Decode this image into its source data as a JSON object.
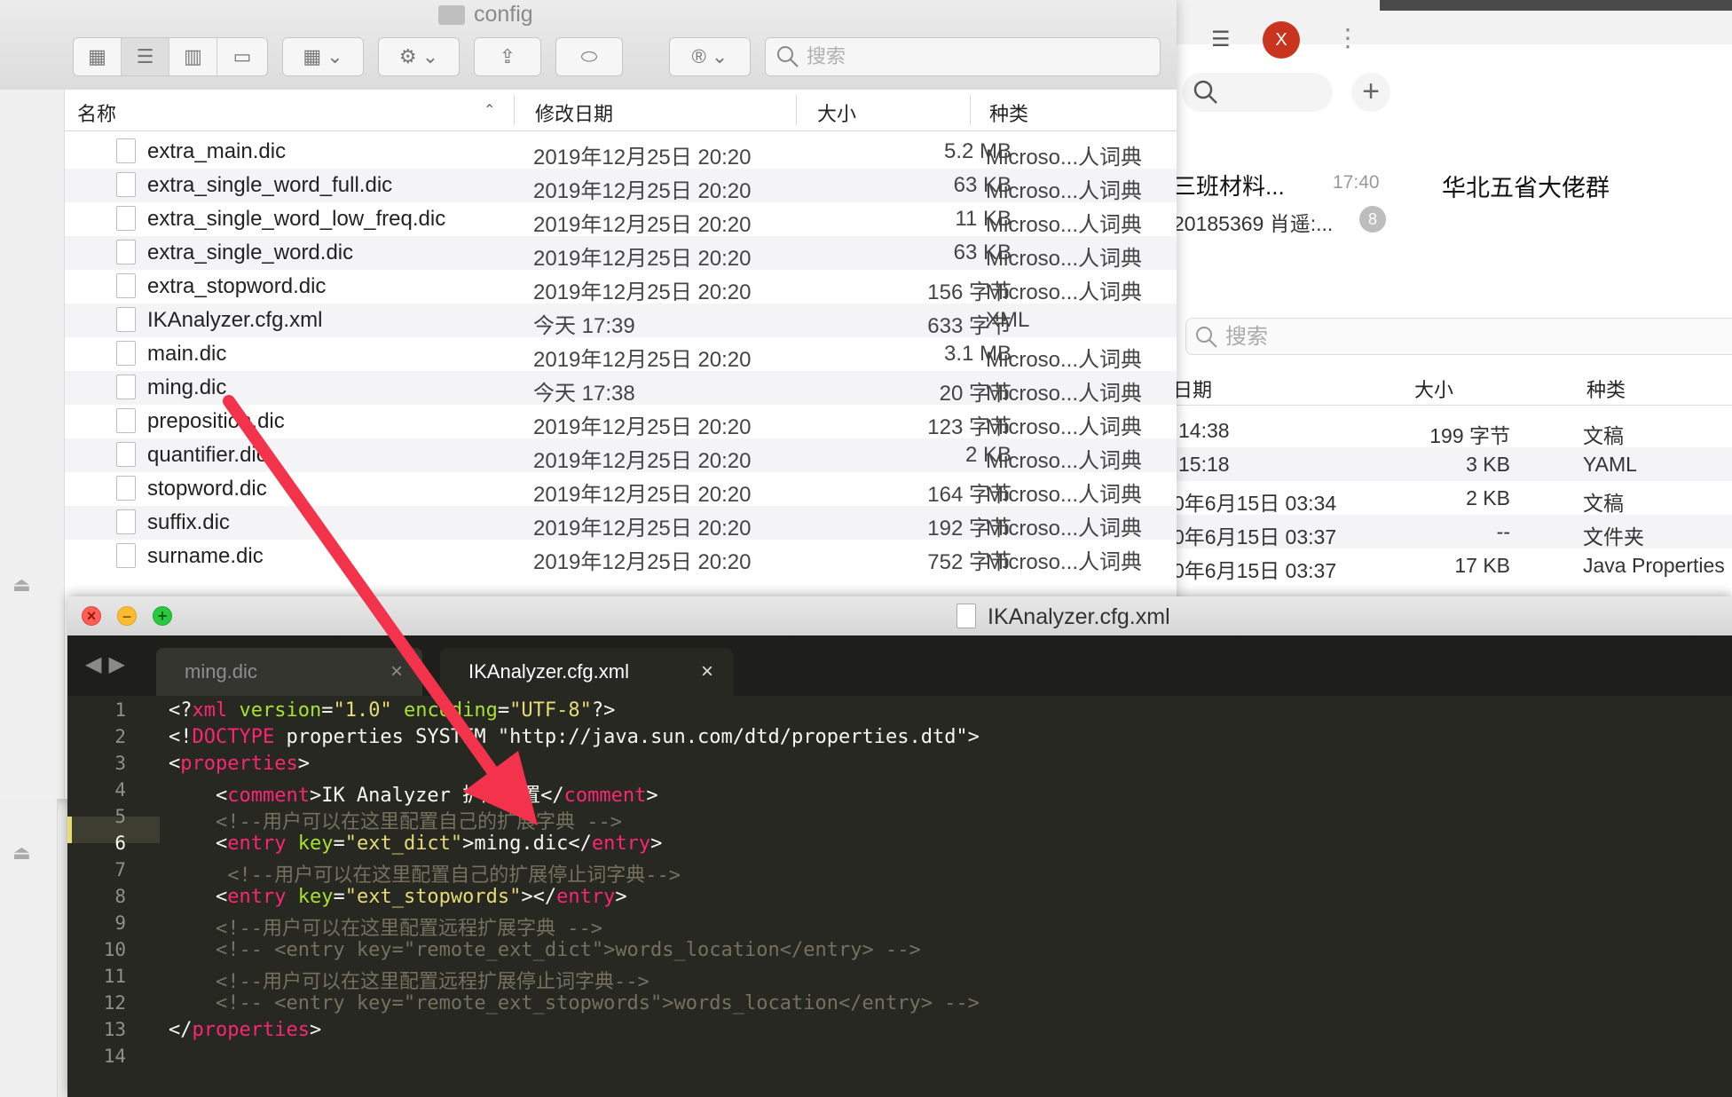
{
  "finder": {
    "window_title": "config",
    "search_placeholder": "搜索",
    "columns": {
      "name": "名称",
      "modified": "修改日期",
      "size": "大小",
      "kind": "种类"
    },
    "files": [
      {
        "name": "extra_main.dic",
        "date": "2019年12月25日 20:20",
        "size": "5.2 MB",
        "kind": "Microso...人词典"
      },
      {
        "name": "extra_single_word_full.dic",
        "date": "2019年12月25日 20:20",
        "size": "63 KB",
        "kind": "Microso...人词典"
      },
      {
        "name": "extra_single_word_low_freq.dic",
        "date": "2019年12月25日 20:20",
        "size": "11 KB",
        "kind": "Microso...人词典"
      },
      {
        "name": "extra_single_word.dic",
        "date": "2019年12月25日 20:20",
        "size": "63 KB",
        "kind": "Microso...人词典"
      },
      {
        "name": "extra_stopword.dic",
        "date": "2019年12月25日 20:20",
        "size": "156 字节",
        "kind": "Microso...人词典"
      },
      {
        "name": "IKAnalyzer.cfg.xml",
        "date": "今天 17:39",
        "size": "633 字节",
        "kind": "XML"
      },
      {
        "name": "main.dic",
        "date": "2019年12月25日 20:20",
        "size": "3.1 MB",
        "kind": "Microso...人词典"
      },
      {
        "name": "ming.dic",
        "date": "今天 17:38",
        "size": "20 字节",
        "kind": "Microso...人词典"
      },
      {
        "name": "preposition.dic",
        "date": "2019年12月25日 20:20",
        "size": "123 字节",
        "kind": "Microso...人词典"
      },
      {
        "name": "quantifier.dic",
        "date": "2019年12月25日 20:20",
        "size": "2 KB",
        "kind": "Microso...人词典"
      },
      {
        "name": "stopword.dic",
        "date": "2019年12月25日 20:20",
        "size": "164 字节",
        "kind": "Microso...人词典"
      },
      {
        "name": "suffix.dic",
        "date": "2019年12月25日 20:20",
        "size": "192 字节",
        "kind": "Microso...人词典"
      },
      {
        "name": "surname.dic",
        "date": "2019年12月25日 20:20",
        "size": "752 字节",
        "kind": "Microso...人词典"
      }
    ]
  },
  "chat": {
    "avatar_letter": "X",
    "conv_title": "三班材料...",
    "conv_time": "17:40",
    "conv_preview": "20185369 肖遥:...",
    "badge": "8",
    "group_title": "华北五省大佬群"
  },
  "finder2": {
    "search_placeholder": "搜索",
    "columns": {
      "date": "日期",
      "size": "大小",
      "kind": "种类"
    },
    "rows": [
      {
        "date": "14:38",
        "size": "199 字节",
        "kind": "文稿"
      },
      {
        "date": "15:18",
        "size": "3 KB",
        "kind": "YAML"
      },
      {
        "date": "0年6月15日 03:34",
        "size": "2 KB",
        "kind": "文稿"
      },
      {
        "date": "0年6月15日 03:37",
        "size": "--",
        "kind": "文件夹"
      },
      {
        "date": "0年6月15日 03:37",
        "size": "17 KB",
        "kind": "Java Properties"
      }
    ]
  },
  "editor": {
    "window_title": "IKAnalyzer.cfg.xml",
    "tabs": [
      {
        "label": "ming.dic"
      },
      {
        "label": "IKAnalyzer.cfg.xml"
      }
    ],
    "current_line": 6,
    "line_numbers": [
      "1",
      "2",
      "3",
      "4",
      "5",
      "6",
      "7",
      "8",
      "9",
      "10",
      "11",
      "12",
      "13",
      "14"
    ],
    "code": {
      "l1": [
        "<?",
        "xml",
        " ",
        "version",
        "=",
        "\"1.0\"",
        " ",
        "encoding",
        "=",
        "\"UTF-8\"",
        "?>"
      ],
      "l2": [
        "<!",
        "DOCTYPE",
        " properties SYSTEM \"http://java.sun.com/dtd/properties.dtd\">"
      ],
      "l3": [
        "<",
        "properties",
        ">"
      ],
      "l4": [
        "    <",
        "comment",
        ">IK Analyzer 扩展配置</",
        "comment",
        ">"
      ],
      "l5": "    <!--用户可以在这里配置自己的扩展字典 -->",
      "l6": [
        "    <",
        "entry",
        " ",
        "key",
        "=",
        "\"ext_dict\"",
        ">ming.dic</",
        "entry",
        ">"
      ],
      "l7": "     <!--用户可以在这里配置自己的扩展停止词字典-->",
      "l8": [
        "    <",
        "entry",
        " ",
        "key",
        "=",
        "\"ext_stopwords\"",
        "></",
        "entry",
        ">"
      ],
      "l9": "    <!--用户可以在这里配置远程扩展字典 -->",
      "l10": "    <!-- <entry key=\"remote_ext_dict\">words_location</entry> -->",
      "l11": "    <!--用户可以在这里配置远程扩展停止词字典-->",
      "l12": "    <!-- <entry key=\"remote_ext_stopwords\">words_location</entry> -->",
      "l13": [
        "</",
        "properties",
        ">"
      ]
    }
  },
  "colors": {
    "arrow": "#f2334b",
    "editor_bg": "#272822",
    "keyword": "#f92672",
    "string": "#e6db74",
    "attribute": "#a6e22e",
    "comment": "#75715e"
  },
  "icons": [
    "icon-view-icon",
    "list-view-icon",
    "column-view-icon",
    "gallery-view-icon",
    "group-icon",
    "gear-icon",
    "share-icon",
    "tag-icon",
    "app-icon",
    "search-icon",
    "plus-icon",
    "menu-icon",
    "more-icon",
    "file-icon",
    "eject-icon",
    "close-icon",
    "minimize-icon",
    "zoom-icon",
    "back-icon",
    "forward-icon"
  ]
}
